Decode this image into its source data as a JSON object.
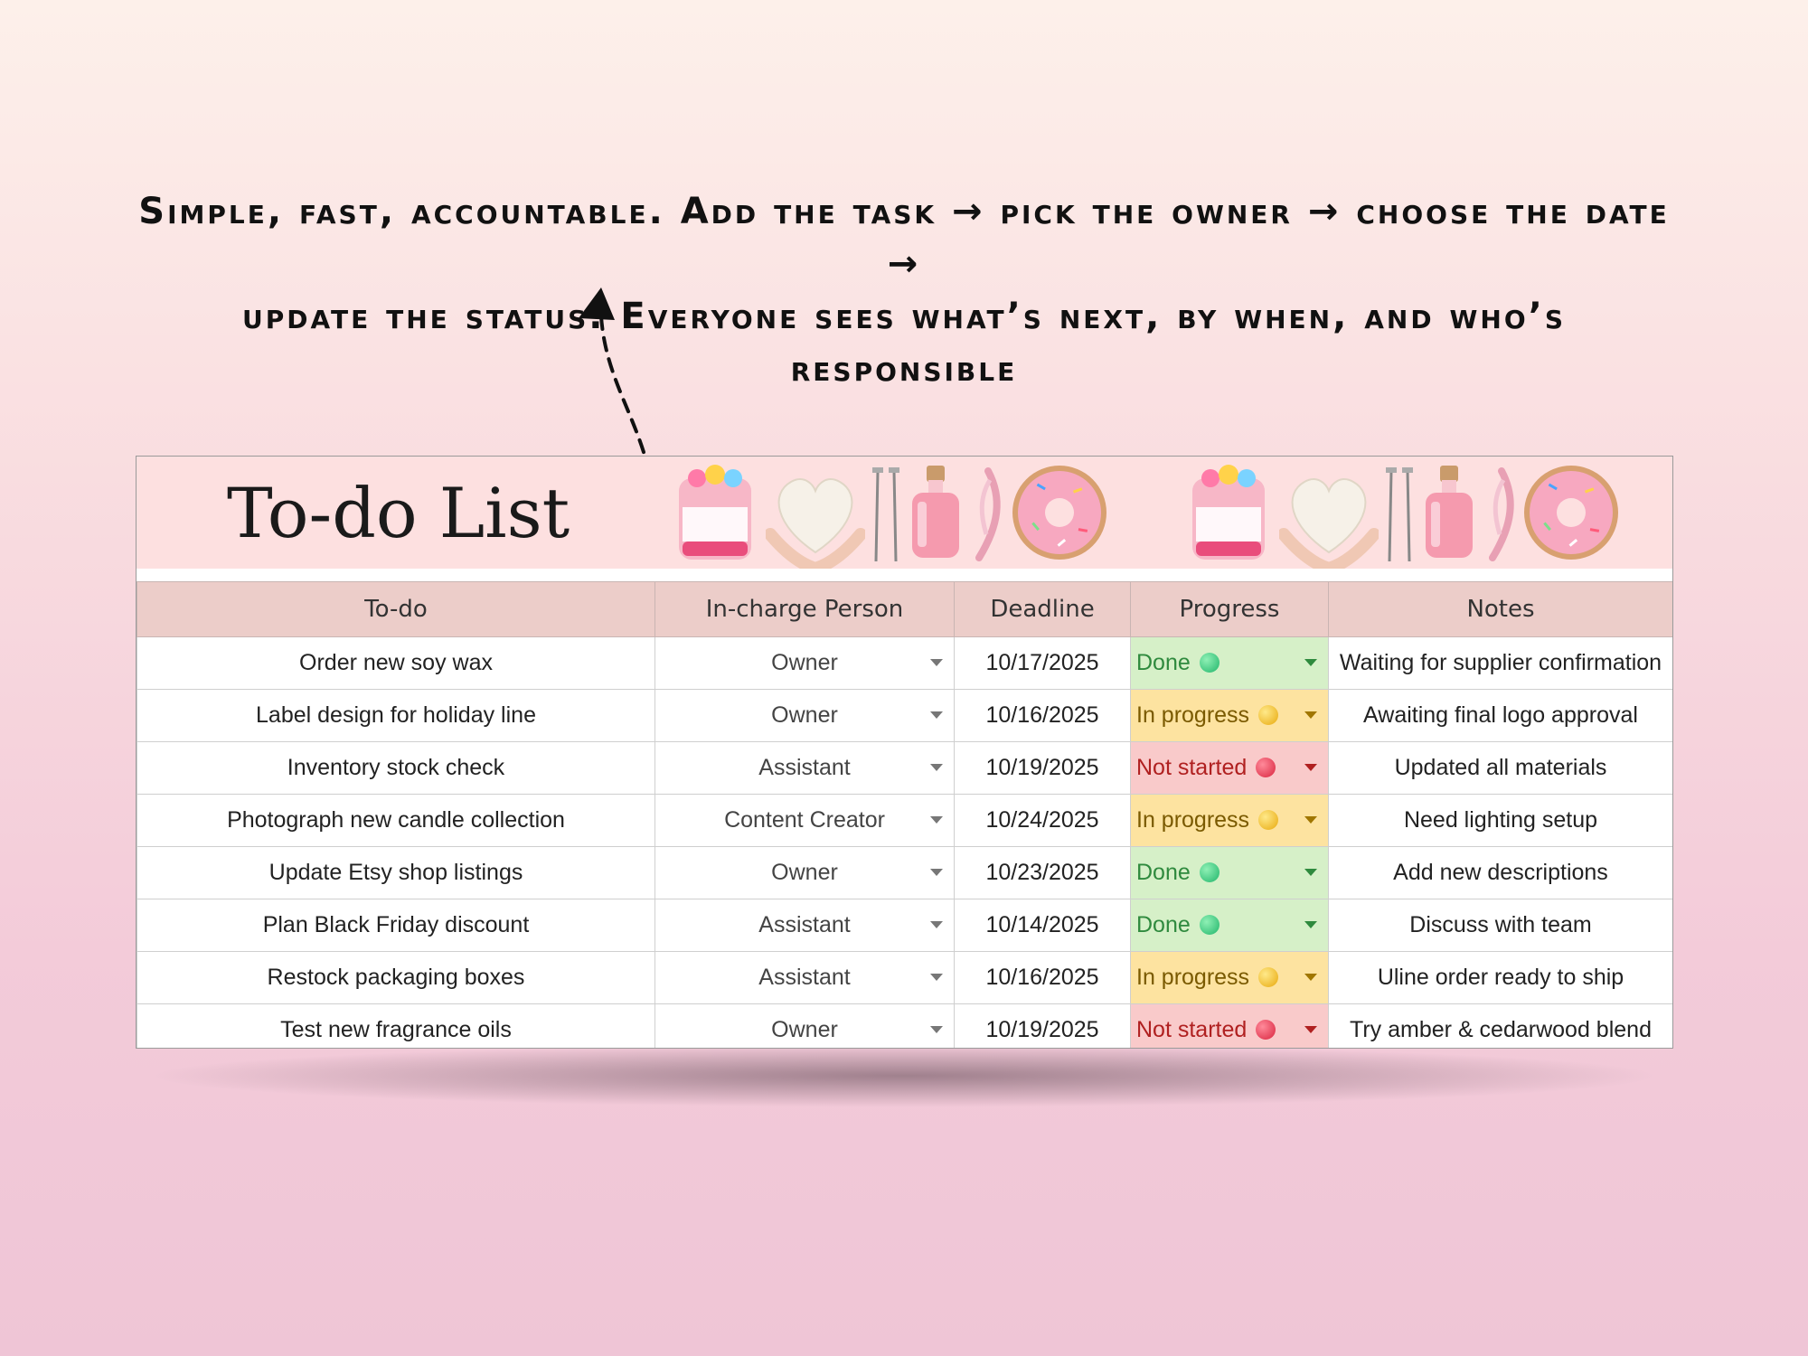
{
  "caption": {
    "line1": "Simple, fast, accountable. Add the task → pick the owner → choose the date →",
    "line2": "update the status. Everyone sees what’s next, by when, and who’s responsible"
  },
  "sheet": {
    "title": "To-do List",
    "columns": [
      "To-do",
      "In-charge Person",
      "Deadline",
      "Progress",
      "Notes"
    ],
    "rows": [
      {
        "task": "Order new soy wax",
        "person": "Owner",
        "deadline": "10/17/2025",
        "status": "Done",
        "notes": "Waiting for supplier confirmation"
      },
      {
        "task": "Label design for holiday line",
        "person": "Owner",
        "deadline": "10/16/2025",
        "status": "In progress",
        "notes": "Awaiting final logo approval"
      },
      {
        "task": "Inventory stock check",
        "person": "Assistant",
        "deadline": "10/19/2025",
        "status": "Not started",
        "notes": "Updated all materials"
      },
      {
        "task": "Photograph new candle collection",
        "person": "Content Creator",
        "deadline": "10/24/2025",
        "status": "In progress",
        "notes": "Need lighting setup"
      },
      {
        "task": "Update Etsy shop listings",
        "person": "Owner",
        "deadline": "10/23/2025",
        "status": "Done",
        "notes": "Add new descriptions"
      },
      {
        "task": "Plan Black Friday discount",
        "person": "Assistant",
        "deadline": "10/14/2025",
        "status": "Done",
        "notes": "Discuss with team"
      },
      {
        "task": "Restock packaging boxes",
        "person": "Assistant",
        "deadline": "10/16/2025",
        "status": "In progress",
        "notes": "Uline order ready to ship"
      },
      {
        "task": "Test new fragrance oils",
        "person": "Owner",
        "deadline": "10/19/2025",
        "status": "Not started",
        "notes": "Try amber & cedarwood blend"
      }
    ]
  },
  "colors": {
    "done": "#d6f0c8",
    "in_progress": "#fde3a0",
    "not_started": "#f9caca",
    "header": "#eccdc9",
    "banner": "#fde0e0"
  },
  "icons": [
    "candle-jar-icon",
    "heart-wax-flakes-icon",
    "wick-pins-icon",
    "fragrance-bottle-icon",
    "dried-flower-icon",
    "sprinkle-donut-icon"
  ]
}
